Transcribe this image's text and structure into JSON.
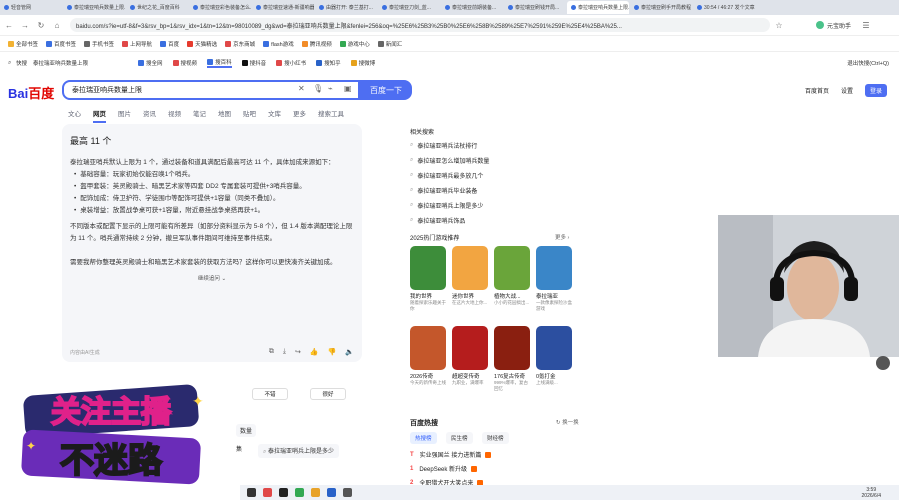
{
  "browser": {
    "tabs": [
      {
        "label": "轻音管网",
        "active": false
      },
      {
        "label": "泰拉瑞亚响兵数量上限...",
        "active": false
      },
      {
        "label": "世纪之花_百度百科",
        "active": false
      },
      {
        "label": "泰拉瑞亚彩色装备怎么...",
        "active": false
      },
      {
        "label": "泰拉瑞亚速通-新疆响器...",
        "active": false
      },
      {
        "label": "由器打开: 泰兰基打...",
        "active": false
      },
      {
        "label": "泰拉瑞亚刀剑_蓝...",
        "active": false
      },
      {
        "label": "泰拉瑞亚前期装备...",
        "active": false
      },
      {
        "label": "泰拉瑞亚刷钱开局...",
        "active": false
      },
      {
        "label": "泰拉瑞亚响兵数量上限...",
        "active": true
      },
      {
        "label": "泰拉瑞亚刷手开局教程 第三...",
        "active": false
      },
      {
        "label": "30:54 / 46:27 发个文章的...",
        "active": false
      }
    ],
    "url": "baidu.com/s?ie=utf-8&f=3&rsv_bp=1&rsv_idx=1&tn=12&tn=98010089_dg&wd=泰拉瑞亚响兵数量上限&fenlei=256&oq=%25E6%25B3%25B0%25E6%258B%2589%25E7%2591%259E%25E4%25BA%25...",
    "bookmarks": [
      "全部书签",
      "百度书签",
      "手机书签",
      "上网导航",
      "百度",
      "天猫精选",
      "京东商城",
      "flash游戏",
      "腾讯视频",
      "游戏中心",
      "新闻汇"
    ],
    "profile": "元宝助手",
    "quick_search_label": "快搜",
    "quick_search_query": "泰拉瑞亚响兵数量上限",
    "quick_engines": [
      "搜全网",
      "搜视频",
      "搜百科",
      "搜抖音",
      "搜小红书",
      "搜知乎",
      "搜微博"
    ],
    "exit_quick": "退出快搜(Ctrl+Q)"
  },
  "search": {
    "logo_blue": "Bai",
    "logo_red": "百度",
    "query": "泰拉瑞亚响兵数量上限",
    "button": "百度一下",
    "top_links": [
      "百度首页",
      "设置"
    ],
    "login": "登录",
    "tabs": [
      "文心",
      "网页",
      "图片",
      "资讯",
      "视频",
      "笔记",
      "地图",
      "贴吧",
      "文库",
      "更多",
      "搜索工具"
    ]
  },
  "answer": {
    "title": "最高 11 个",
    "intro": "泰拉瑞亚哨兵默认上限为 1 个，通过装备和道具满配后最高可达 11 个，具体加成来源如下：",
    "bullets": [
      "基础容量：玩家初始仅能召唤1个哨兵。",
      "盔甲套装：英灵殿骑士、暗黑艺术家等四套 DD2 专属套装可提供+3哨兵容量。",
      "配饰加成：侍卫护符、学徒围巾等配饰可提供+1容量（同类不叠加）。",
      "桌装增益：放置战争桌可获+1容量，附近悬挂战争桌搭再获+1。"
    ],
    "outro": "不同版本或配置下显示的上限可能有所差异（如部分资料显示为 5-8 个），但 1.4 版本满配理论上限为 11 个。哨兵通常持续 2 分钟，撤旦军队事件期间可维持至事件结束。",
    "followup": "需要我帮你整理英灵殿骑士和暗黑艺术家套装的获取方法吗？这样你可以更快凑齐关键加成。",
    "expand": "继续追问",
    "footer": "内容由AI生成"
  },
  "feedback": {
    "bad": "不错",
    "good": "很好"
  },
  "chips": {
    "chip1": "数量",
    "chip2": "集",
    "chip3": "泰拉瑞亚哨兵上限是多少"
  },
  "related": {
    "title": "相关搜索",
    "items": [
      "泰拉瑞亚哨兵法杖排行",
      "泰拉瑞亚怎么增加哨兵数量",
      "泰拉瑞亚哨兵最多放几个",
      "泰拉瑞亚哨兵毕业装备",
      "泰拉瑞亚哨兵上限是多少",
      "泰拉瑞亚哨兵饰品"
    ]
  },
  "hot_games": {
    "title": "2025热门游戏推荐",
    "more": "更多",
    "games": [
      {
        "name": "我的世界",
        "desc": "随着探索乐趣关于你",
        "color": "#3d8d3a"
      },
      {
        "name": "迷你世界",
        "desc": "在这片大地上你...",
        "color": "#f2a541"
      },
      {
        "name": "植物大战...",
        "desc": "小小的花园搞出...",
        "color": "#6aa53a"
      },
      {
        "name": "泰拉瑞亚",
        "desc": "一款像素探险沙盒游戏",
        "color": "#3a86c8"
      },
      {
        "name": "2026传奇",
        "desc": "今天的新传奇上线",
        "color": "#c4572b"
      },
      {
        "name": "超超变传奇",
        "desc": "九职业，满爆率",
        "color": "#b51d1d"
      },
      {
        "name": "176复古传奇",
        "desc": "999%爆率，复古回忆",
        "color": "#8a1f10"
      },
      {
        "name": "0氪打金",
        "desc": "上线满级...",
        "color": "#2c4fa0"
      }
    ]
  },
  "hot": {
    "title": "百度热搜",
    "refresh": "换一换",
    "tabs": [
      "热搜榜",
      "民生榜",
      "财经榜"
    ],
    "items": [
      {
        "rank": "T",
        "text": "实业强国兰 接力进新篇"
      },
      {
        "rank": "1",
        "text": "DeepSeek 新升级"
      },
      {
        "rank": "2",
        "text": "全职猎犬开大笑点来"
      }
    ]
  },
  "taskbar": {
    "time": "3:59",
    "date": "2026/6/4"
  },
  "sticker": {
    "line1": "关注主播",
    "line2": "不迷路"
  }
}
